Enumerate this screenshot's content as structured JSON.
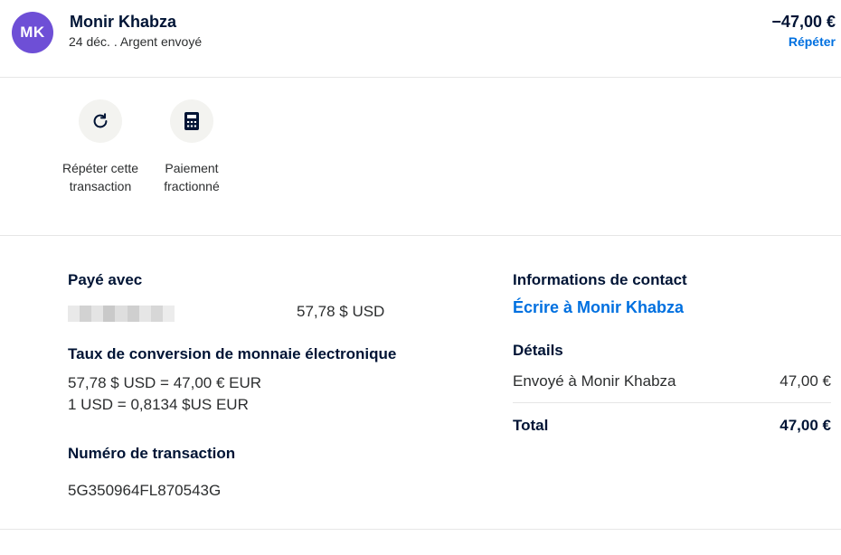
{
  "header": {
    "avatar_initials": "MK",
    "name": "Monir Khabza",
    "subtitle": "24 déc. . Argent envoyé",
    "amount": "−47,00 €",
    "repeat_link": "Répéter"
  },
  "actions": [
    {
      "label": "Répéter cette transaction",
      "icon": "refresh-icon"
    },
    {
      "label": "Paiement fractionné",
      "icon": "calculator-icon"
    }
  ],
  "paid_with": {
    "title": "Payé avec",
    "source_hidden": true,
    "amount": "57,78 $ USD"
  },
  "conversion": {
    "title": "Taux de conversion de monnaie électronique",
    "line1": "57,78 $ USD = 47,00 € EUR",
    "line2": "1 USD = 0,8134 $US EUR"
  },
  "transaction": {
    "title": "Numéro de transaction",
    "id": "5G350964FL870543G"
  },
  "contact": {
    "title": "Informations de contact",
    "link": "Écrire à Monir Khabza"
  },
  "details": {
    "title": "Détails",
    "sent_label": "Envoyé à Monir Khabza",
    "sent_value": "47,00 €",
    "total_label": "Total",
    "total_value": "47,00 €"
  },
  "colors": {
    "avatar": "#6e4fd6",
    "link": "#0070e0",
    "text_dark": "#001435"
  }
}
